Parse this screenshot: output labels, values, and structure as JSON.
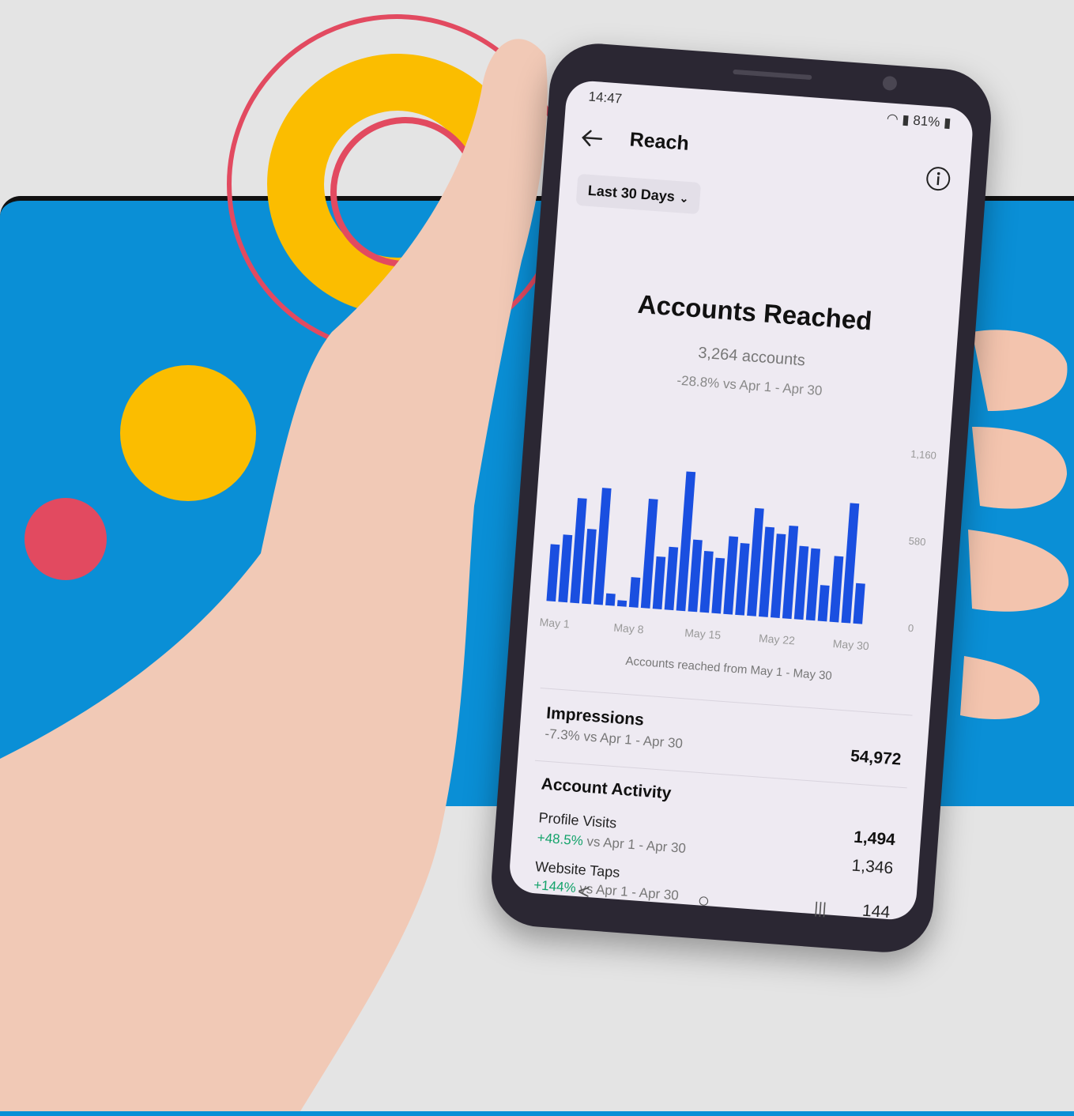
{
  "colors": {
    "background": "#e4e4e4",
    "panel": "#0a8fd6",
    "accent_yellow": "#fbbd00",
    "accent_red": "#e24a60",
    "bar": "#1a4fe0",
    "positive": "#14a36b"
  },
  "status_bar": {
    "time": "14:47",
    "battery": "81%"
  },
  "appbar": {
    "title": "Reach",
    "back_icon": "arrow-left-icon",
    "info_icon": "info-icon"
  },
  "filter": {
    "label": "Last 30 Days",
    "icon": "chevron-down-icon"
  },
  "accounts_reached": {
    "title": "Accounts Reached",
    "count": "3,264 accounts",
    "change": "-28.8% vs Apr 1 - Apr 30"
  },
  "chart_data": {
    "type": "bar",
    "x_tick_labels": [
      "May 1",
      "May 8",
      "May 15",
      "May 22",
      "May 30"
    ],
    "y_tick_labels": [
      "1,160",
      "580",
      "0"
    ],
    "ylim": [
      0,
      1160
    ],
    "caption": "Accounts reached from May 1 - May 30",
    "values": [
      380,
      450,
      700,
      500,
      780,
      80,
      40,
      200,
      730,
      350,
      420,
      930,
      480,
      410,
      370,
      520,
      480,
      720,
      600,
      560,
      620,
      490,
      480,
      240,
      440,
      800,
      270
    ],
    "grid": false,
    "legend": "none"
  },
  "impressions": {
    "title": "Impressions",
    "change": "-7.3% vs Apr 1 - Apr 30",
    "value": "54,972"
  },
  "account_activity": {
    "title": "Account Activity",
    "total": "1,494",
    "profile_visits": {
      "label": "Profile Visits",
      "change_pct": "+48.5%",
      "change_rest": " vs Apr 1 - Apr 30",
      "value": "1,346"
    },
    "website_taps": {
      "label": "Website Taps",
      "change_pct": "+144%",
      "change_rest": " vs Apr 1 - Apr 30",
      "value": "144"
    }
  },
  "nav_bar": {
    "back": "<",
    "home": "○",
    "recents": "|||"
  }
}
